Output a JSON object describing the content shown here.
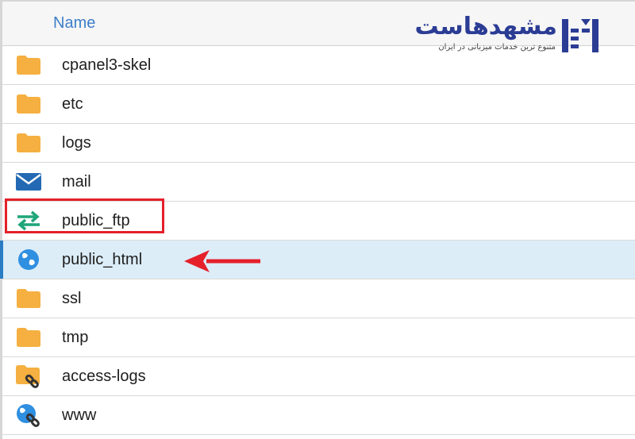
{
  "header": {
    "name_column": "Name"
  },
  "files": [
    {
      "name": "cpanel3-skel",
      "icon": "folder-icon",
      "selected": false
    },
    {
      "name": "etc",
      "icon": "folder-icon",
      "selected": false
    },
    {
      "name": "logs",
      "icon": "folder-icon",
      "selected": false
    },
    {
      "name": "mail",
      "icon": "mail-icon",
      "selected": false
    },
    {
      "name": "public_ftp",
      "icon": "transfer-arrows-icon",
      "selected": false
    },
    {
      "name": "public_html",
      "icon": "globe-icon",
      "selected": true
    },
    {
      "name": "ssl",
      "icon": "folder-icon",
      "selected": false
    },
    {
      "name": "tmp",
      "icon": "folder-icon",
      "selected": false
    },
    {
      "name": "access-logs",
      "icon": "folder-link-icon",
      "selected": false
    },
    {
      "name": "www",
      "icon": "globe-link-icon",
      "selected": false
    }
  ],
  "logo": {
    "text": "مشهدهاست",
    "tagline": "متنوع ترین خدمات میزبانی در ایران"
  },
  "colors": {
    "folder": "#f5b041",
    "mail": "#2369b3",
    "transfer": "#1fa67a",
    "globe": "#2f8fe0",
    "selected_row": "#dcedf8",
    "highlight": "#e5202a",
    "header_text": "#3d7ec9",
    "logo": "#2b3c95"
  }
}
